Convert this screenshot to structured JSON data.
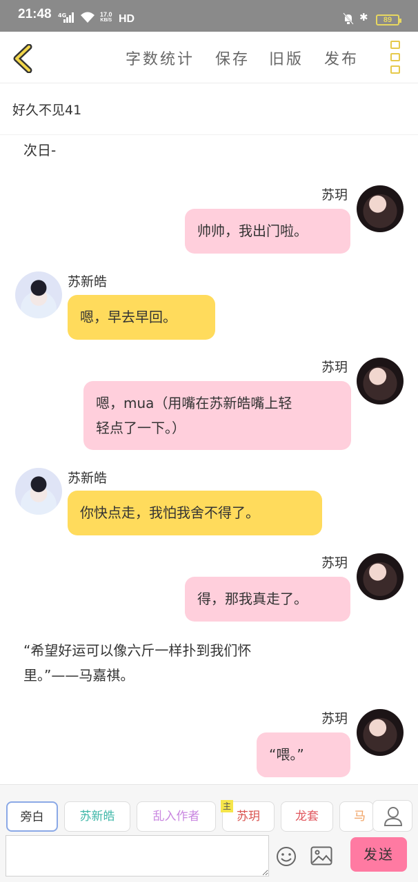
{
  "status_bar": {
    "time": "21:48",
    "network": "4G",
    "speed_value": "17.0",
    "speed_unit": "KB/S",
    "hd": "HD",
    "battery": "89"
  },
  "toolbar": {
    "word_count": "字数统计",
    "save": "保存",
    "old_version": "旧版",
    "publish": "发布"
  },
  "title": "好久不见41",
  "messages": [
    {
      "type": "narration",
      "text": "次日-"
    },
    {
      "type": "right",
      "name": "苏玥",
      "text": "帅帅，我出门啦。"
    },
    {
      "type": "left",
      "name": "苏新皓",
      "text": "嗯，早去早回。"
    },
    {
      "type": "right",
      "name": "苏玥",
      "lines": [
        "嗯，mua（用嘴在苏新皓嘴上轻",
        "轻点了一下。）"
      ]
    },
    {
      "type": "left",
      "name": "苏新皓",
      "text": "你快点走，我怕我舍不得了。"
    },
    {
      "type": "right",
      "name": "苏玥",
      "text": "得，那我真走了。"
    },
    {
      "type": "narration",
      "lines": [
        "“希望好运可以像六斤一样扑到我们怀",
        "里。”——马嘉祺。"
      ]
    },
    {
      "type": "right",
      "name": "苏玥",
      "text": "“喂。”"
    }
  ],
  "roles": [
    {
      "label": "旁白",
      "color": "#333333"
    },
    {
      "label": "苏新皓",
      "color": "#3fb7a8"
    },
    {
      "label": "乱入作者",
      "color": "#c986e0"
    },
    {
      "label": "苏玥",
      "color": "#d9534f",
      "badge": "主"
    },
    {
      "label": "龙套",
      "color": "#e0555c"
    },
    {
      "label": "马嘉",
      "color": "#f0a060"
    }
  ],
  "input": {
    "placeholder": ""
  },
  "send_label": "发送",
  "colors": {
    "pink_bubble": "#ffcfdc",
    "yellow_bubble": "#ffdb5c",
    "send": "#ff7aa2",
    "accent": "#e6c94a"
  }
}
